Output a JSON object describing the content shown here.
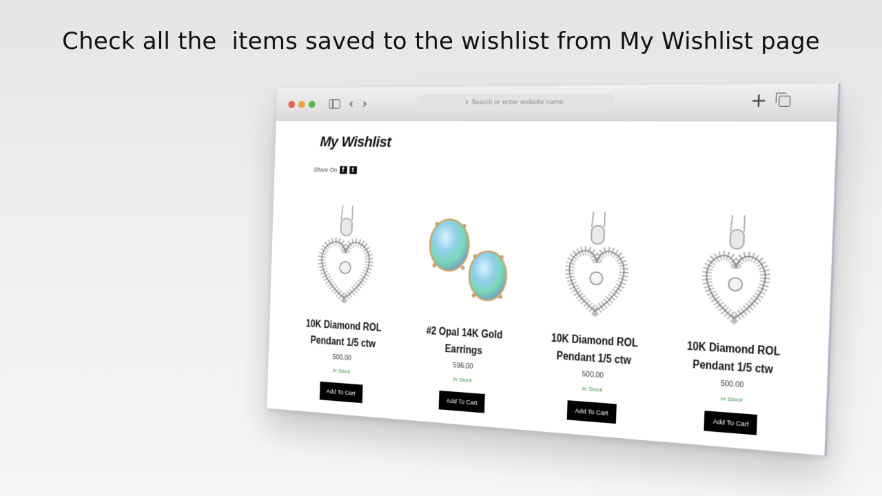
{
  "headline": "Check all the  items saved to the wishlist from My Wishlist page",
  "browser": {
    "address_placeholder": "Search or enter website name"
  },
  "page": {
    "title": "My Wishlist",
    "share_label": "Share On"
  },
  "products": [
    {
      "name_line1": "10K Diamond ROL",
      "name_line2": "Pendant 1/5 ctw",
      "price": "500.00",
      "stock": "In Stock",
      "button": "Add To Cart",
      "image": "heart-pendant"
    },
    {
      "name_line1": "#2 Opal 14K Gold",
      "name_line2": "Earrings",
      "price": "596.00",
      "stock": "In Stock",
      "button": "Add To Cart",
      "image": "opal-earrings"
    },
    {
      "name_line1": "10K Diamond ROL",
      "name_line2": "Pendant 1/5 ctw",
      "price": "500.00",
      "stock": "In Stock",
      "button": "Add To Cart",
      "image": "heart-pendant"
    },
    {
      "name_line1": "10K Diamond ROL",
      "name_line2": "Pendant 1/5 ctw",
      "price": "500.00",
      "stock": "In Stock",
      "button": "Add To Cart",
      "image": "heart-pendant"
    }
  ],
  "colors": {
    "in_stock": "#2e8b3c",
    "button_bg": "#000000",
    "traffic_red": "#ec5b55",
    "traffic_yellow": "#e8a33c",
    "traffic_green": "#57b947"
  }
}
